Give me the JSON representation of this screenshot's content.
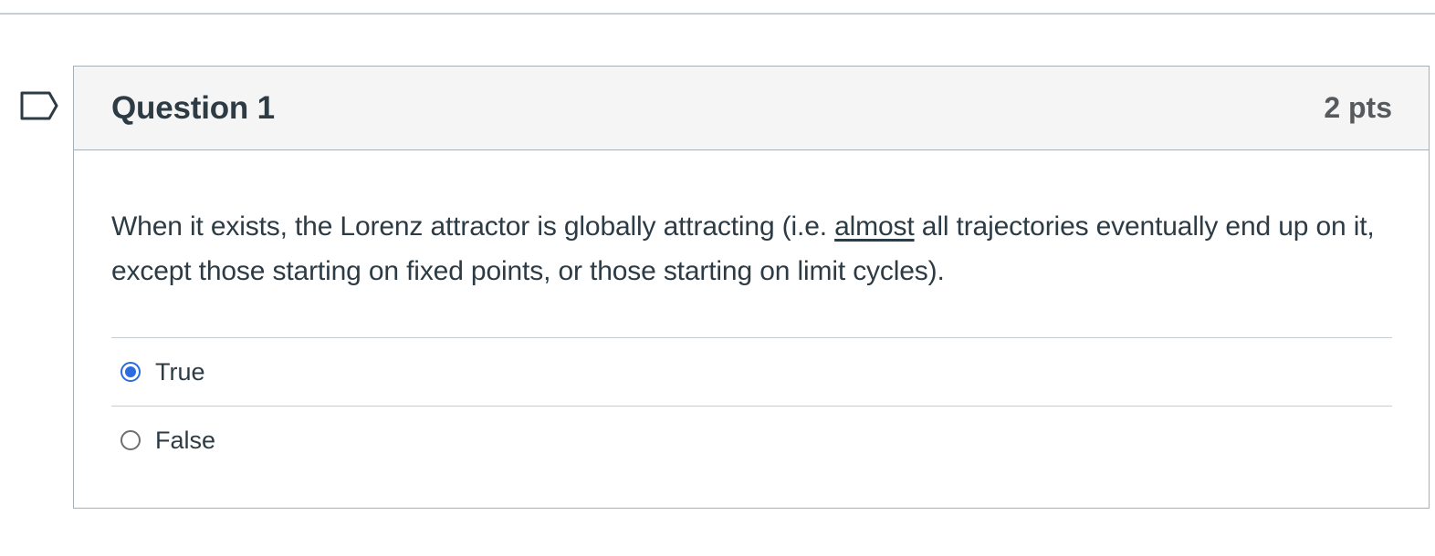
{
  "question": {
    "title": "Question 1",
    "points": "2 pts",
    "text_before": "When it exists, the Lorenz attractor is globally attracting (i.e. ",
    "text_emphasis": "almost",
    "text_after": " all trajectories eventually end up on it, except those starting on fixed points, or those starting on limit cycles).",
    "flag_icon": "bookmark-flag-icon"
  },
  "answers": [
    {
      "label": "True",
      "selected": true
    },
    {
      "label": "False",
      "selected": false
    }
  ],
  "colors": {
    "accent": "#2b6ce0",
    "text": "#2d3b45",
    "header_bg": "#f5f5f5",
    "border": "#a5afb5"
  }
}
